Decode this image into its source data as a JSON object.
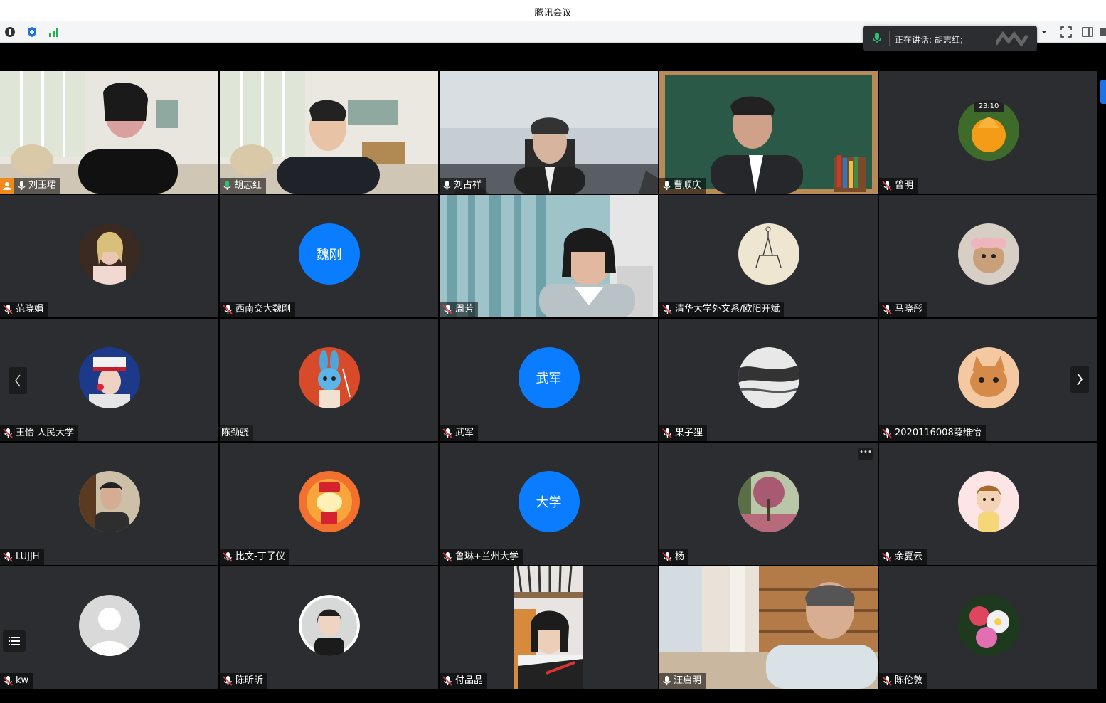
{
  "window": {
    "title": "腾讯会议"
  },
  "speaking": {
    "text": "正在讲话: 胡志红;"
  },
  "participants": [
    {
      "name": "刘玉珺",
      "kind": "video",
      "scene": "room",
      "host": true
    },
    {
      "name": "胡志红",
      "kind": "video",
      "scene": "room2"
    },
    {
      "name": "刘占祥",
      "kind": "video",
      "scene": "office"
    },
    {
      "name": "曹顺庆",
      "kind": "video",
      "scene": "chalk"
    },
    {
      "name": "曾明",
      "kind": "avatar",
      "img": "flower-orange"
    },
    {
      "name": "范晓娟",
      "kind": "avatar",
      "img": "woman"
    },
    {
      "name": "西南交大魏刚",
      "kind": "text",
      "avatar_text": "魏刚"
    },
    {
      "name": "周芳",
      "kind": "video",
      "scene": "curtain"
    },
    {
      "name": "清华大学外文系/欧阳开斌",
      "kind": "avatar",
      "img": "sketch"
    },
    {
      "name": "马晓彤",
      "kind": "avatar",
      "img": "bear"
    },
    {
      "name": "王怡 人民大学",
      "kind": "avatar",
      "img": "costume"
    },
    {
      "name": "陈劲骁",
      "kind": "avatar",
      "img": "rabbit",
      "plain": true
    },
    {
      "name": "武军",
      "kind": "text",
      "avatar_text": "武军"
    },
    {
      "name": "果子狸",
      "kind": "avatar",
      "img": "ink"
    },
    {
      "name": "2020116008薛维怡",
      "kind": "avatar",
      "img": "cat"
    },
    {
      "name": "LUJJH",
      "kind": "avatar",
      "img": "man"
    },
    {
      "name": "比文-丁子仪",
      "kind": "avatar",
      "img": "dog"
    },
    {
      "name": "鲁琳+兰州大学",
      "kind": "text",
      "avatar_text": "大学"
    },
    {
      "name": "杨",
      "kind": "avatar",
      "img": "tree"
    },
    {
      "name": "余夏云",
      "kind": "avatar",
      "img": "cartoon"
    },
    {
      "name": "kw",
      "kind": "avatar",
      "img": "default"
    },
    {
      "name": "陈昕昕",
      "kind": "avatar",
      "img": "girl"
    },
    {
      "name": "付品晶",
      "kind": "video",
      "scene": "portrait"
    },
    {
      "name": "汪启明",
      "kind": "video",
      "scene": "library"
    },
    {
      "name": "陈伦敦",
      "kind": "avatar",
      "img": "peony"
    }
  ],
  "colors": {
    "tile_bg": "#2b2d31",
    "speaking_border": "#2ec56a",
    "text_avatar": "#0a7cff",
    "host_badge": "#f08a1c"
  }
}
